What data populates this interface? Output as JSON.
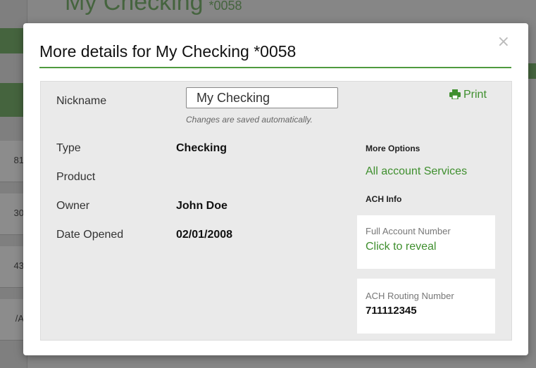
{
  "background": {
    "page_title": "My Checking",
    "page_title_acct": "*0058",
    "left_cells": [
      "81",
      "30",
      "43",
      "/A"
    ]
  },
  "modal": {
    "title": "More details for My Checking *0058",
    "close_glyph": "×",
    "print_label": "Print",
    "nickname": {
      "label": "Nickname",
      "value": "My Checking",
      "hint": "Changes are saved automatically."
    },
    "fields": [
      {
        "label": "Type",
        "value": "Checking"
      },
      {
        "label": "Product",
        "value": ""
      },
      {
        "label": "Owner",
        "value": "John Doe"
      },
      {
        "label": "Date Opened",
        "value": "02/01/2008"
      }
    ],
    "more_options": {
      "heading": "More Options",
      "link": "All account Services"
    },
    "ach": {
      "heading": "ACH Info",
      "account_label": "Full Account Number",
      "account_link": "Click to reveal",
      "routing_label": "ACH Routing Number",
      "routing_value": "711112345"
    }
  },
  "colors": {
    "accent_green": "#3f8f2e",
    "rule_green": "#4e9a3e",
    "panel_bg": "#eaeaea"
  }
}
